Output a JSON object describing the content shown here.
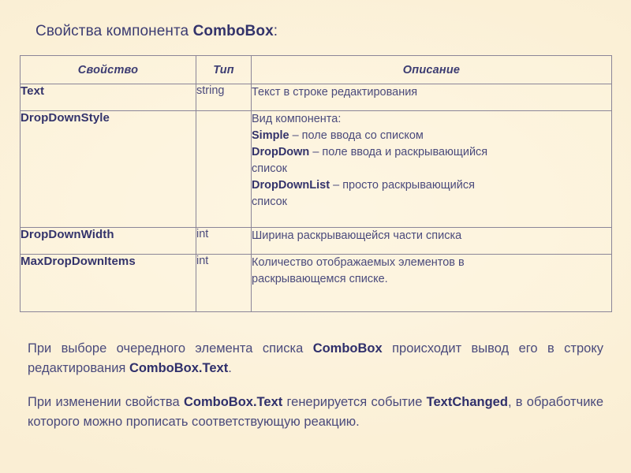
{
  "slide": {
    "title_prefix": "Свойства компонента ",
    "title_strong": "ComboBox",
    "title_suffix": ":"
  },
  "table": {
    "headers": {
      "property": "Свойство",
      "type": "Тип",
      "description": "Описание"
    },
    "rows": [
      {
        "property": "Text",
        "type": "string",
        "description": "Текст в строке редактирования"
      },
      {
        "property": "DropDownStyle",
        "type": "",
        "description_lines": [
          {
            "kw": "",
            "rest": "Вид компонента:"
          },
          {
            "kw": "Simple",
            "rest": " – поле ввода со списком"
          },
          {
            "kw": "DropDown",
            "rest": " – поле ввода и раскрывающийся"
          },
          {
            "kw": "",
            "rest": "список"
          },
          {
            "kw": "DropDownList",
            "rest": " – просто раскрывающийся"
          },
          {
            "kw": "",
            "rest": "список"
          }
        ]
      },
      {
        "property": "DropDownWidth",
        "type": "int",
        "description": "Ширина раскрывающейся части списка"
      },
      {
        "property": "MaxDropDownItems",
        "type": "int",
        "description_lines": [
          {
            "kw": "",
            "rest": "Количество отображаемых элементов в"
          },
          {
            "kw": "",
            "rest": "раскрывающемся списке."
          }
        ]
      }
    ]
  },
  "paragraphs": [
    {
      "segments": [
        {
          "kw": false,
          "text": "При выборе очередного элемента списка "
        },
        {
          "kw": true,
          "text": "ComboBox"
        },
        {
          "kw": false,
          "text": " происходит вывод его в строку редактирования "
        },
        {
          "kw": true,
          "text": "ComboBox.Text"
        },
        {
          "kw": false,
          "text": "."
        }
      ]
    },
    {
      "segments": [
        {
          "kw": false,
          "text": "При изменении свойства "
        },
        {
          "kw": true,
          "text": "ComboBox.Text"
        },
        {
          "kw": false,
          "text": " генерируется событие "
        },
        {
          "kw": true,
          "text": "TextChanged"
        },
        {
          "kw": false,
          "text": ", в обработчике которого можно прописать соответствующую реакцию."
        }
      ]
    }
  ],
  "colors": {
    "background": "#fbf0d8",
    "heading_text": "#33336b",
    "body_text": "#4a4a7c",
    "table_border": "#8b8598"
  }
}
